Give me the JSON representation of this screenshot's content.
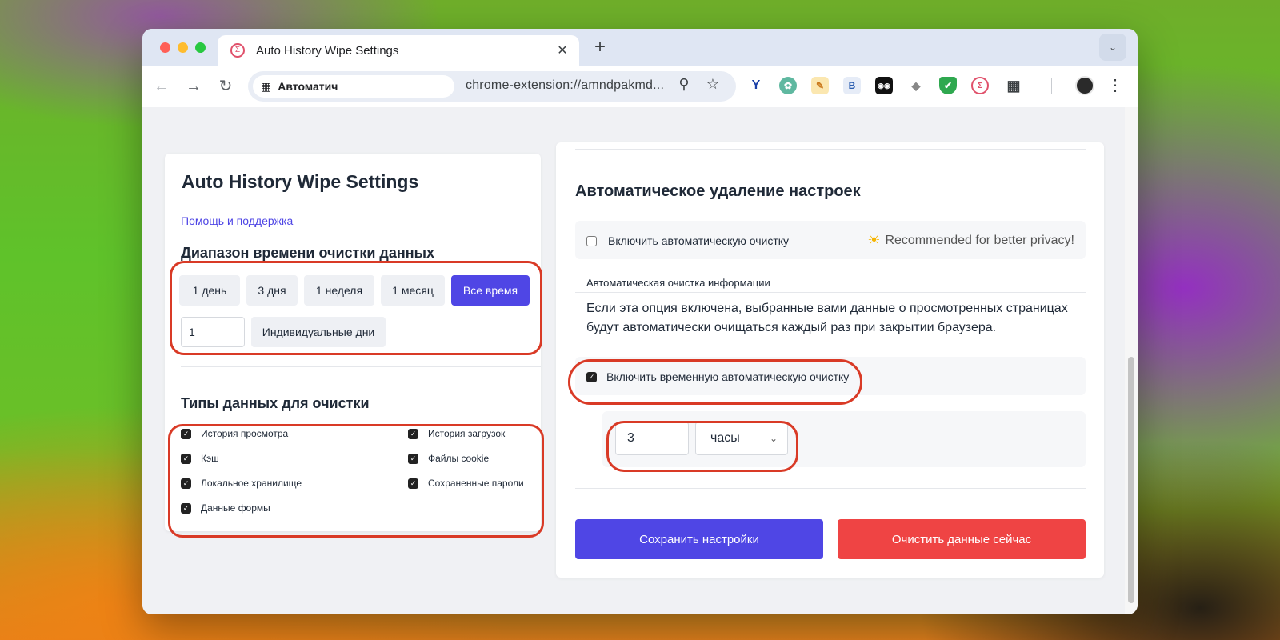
{
  "browser": {
    "tab_title": "Auto History Wipe Settings",
    "tab_close": "✕",
    "new_tab": "+",
    "tab_search_icon": "chevron-down-icon",
    "address_chip_label": "Автоматич",
    "url": "chrome-extension://amndpakmd...",
    "extensions": [
      "Y",
      "✿",
      "✎",
      "B",
      "◉◉",
      "◆",
      "✔",
      "Σ"
    ]
  },
  "left": {
    "title": "Auto History Wipe Settings",
    "help_link": "Помощь и поддержка",
    "time_range_heading": "Диапазон времени очистки данных",
    "range_buttons": [
      "1 день",
      "3 дня",
      "1 неделя",
      "1 месяц",
      "Все время"
    ],
    "active_range": "Все время",
    "custom_days_value": "1",
    "custom_days_button": "Индивидуальные дни",
    "data_types_heading": "Типы данных для очистки",
    "data_types": [
      {
        "label": "История просмотра",
        "checked": true
      },
      {
        "label": "История загрузок",
        "checked": true
      },
      {
        "label": "Кэш",
        "checked": true
      },
      {
        "label": "Файлы cookie",
        "checked": true
      },
      {
        "label": "Локальное хранилище",
        "checked": true
      },
      {
        "label": "Сохраненные пароли",
        "checked": true
      },
      {
        "label": "Данные формы",
        "checked": true
      }
    ]
  },
  "right": {
    "title": "Автоматическое удаление настроек",
    "auto_clean_label": "Включить автоматическую очистку",
    "auto_clean_checked": false,
    "recommended": "Recommended for better privacy!",
    "info_label": "Автоматическая очистка информации",
    "info_text": "Если эта опция включена, выбранные вами данные о просмотренных страницах будут автоматически очищаться каждый раз при закрытии браузера.",
    "temp_clean_label": "Включить временную автоматическую очистку",
    "temp_clean_checked": true,
    "interval_value": "3",
    "interval_unit": "часы",
    "save_button": "Сохранить настройки",
    "clear_button": "Очистить данные сейчас"
  },
  "colors": {
    "accent": "#4f46e5",
    "danger": "#ef4444",
    "highlight": "#d93a26"
  }
}
